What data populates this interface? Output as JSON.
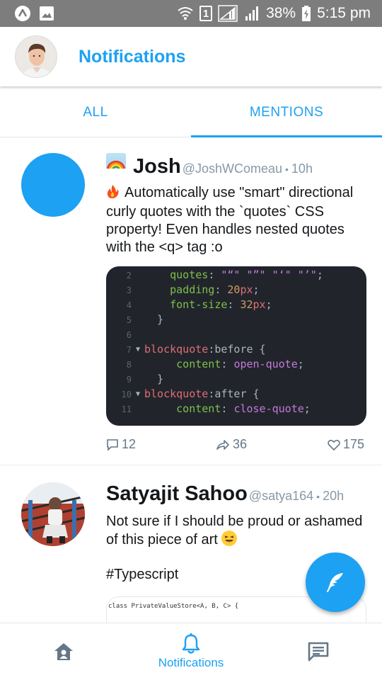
{
  "status_bar": {
    "sim_slot": "1",
    "battery": "38%",
    "time": "5:15 pm"
  },
  "header": {
    "title": "Notifications"
  },
  "tabs": [
    {
      "label": "ALL",
      "active": false
    },
    {
      "label": "MENTIONS",
      "active": true
    }
  ],
  "tweets": [
    {
      "name": "Josh",
      "handle": "@JoshWComeau",
      "time": "10h",
      "text": "Automatically use \"smart\" directional curly quotes with the `quotes` CSS property! Even handles nested quotes with the <q> tag :o",
      "code": {
        "line_numbers": [
          "2",
          "3",
          "4",
          "5",
          "6",
          "7",
          "8",
          "9",
          "10",
          "11"
        ],
        "quotes_prop": "quotes",
        "quotes_value": "\"“\" \"”\" \"‘\" \"’\"",
        "padding_prop": "padding",
        "padding_value": "20",
        "fontsize_prop": "font-size",
        "fontsize_value": "32",
        "unit": "px",
        "selector": "blockquote",
        "pseudo_before": ":before",
        "pseudo_after": ":after",
        "content_prop": "content",
        "open_quote": "open-quote",
        "close_quote": "close-quote"
      },
      "replies": "12",
      "retweets": "36",
      "likes": "175"
    },
    {
      "name": "Satyajit Sahoo",
      "handle": "@satya164",
      "time": "20h",
      "text": "Not sure if I should be proud or ashamed of this piece of art",
      "hashtag": "#Typescript",
      "code_preview": "class PrivateValueStore<A, B, C> {"
    }
  ],
  "bottom_nav": {
    "active_label": "Notifications"
  },
  "colors": {
    "accent": "#1da1f2",
    "status_bar": "#7d7d7d",
    "code_bg": "#21252b"
  }
}
